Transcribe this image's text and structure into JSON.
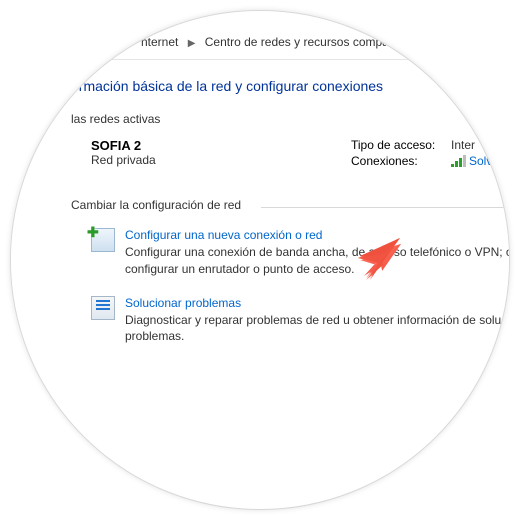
{
  "breadcrumb": {
    "part1": "nternet",
    "part2": "Centro de redes y recursos compartidos"
  },
  "heading": "ormación básica de la red y configurar conexiones",
  "active_section_label": "las redes activas",
  "network": {
    "name": "SOFIA 2",
    "type": "Red privada",
    "access_label": "Tipo de acceso:",
    "access_value": "Inter",
    "conn_label": "Conexiones:",
    "conn_value": "Solve"
  },
  "change_section_label": "Cambiar la configuración de red",
  "options": {
    "setup": {
      "title": "Configurar una nueva conexión o red",
      "desc": "Configurar una conexión de banda ancha, de acceso telefónico o VPN; o bien configurar un enrutador o punto de acceso."
    },
    "troubleshoot": {
      "title": "Solucionar problemas",
      "desc": "Diagnosticar y reparar problemas de red u obtener información de solución de problemas."
    }
  }
}
